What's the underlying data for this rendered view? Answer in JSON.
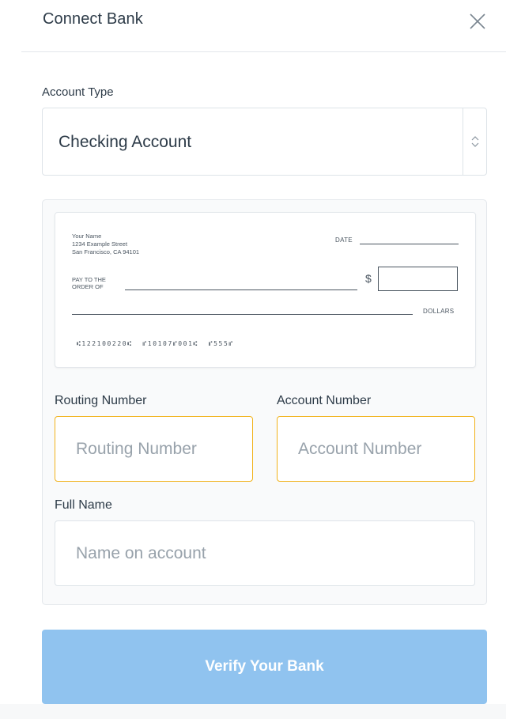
{
  "header": {
    "title": "Connect Bank",
    "close_icon": "close-icon"
  },
  "account_type": {
    "label": "Account Type",
    "selected_value": "Checking Account",
    "arrow_icon": "chevron-up-down-icon"
  },
  "check": {
    "address_line1": "Your Name",
    "address_line2": "1234 Example Street",
    "address_line3": "San Francisco, CA 94101",
    "date_label": "DATE",
    "pay_to_line1": "PAY TO THE",
    "pay_to_line2": "ORDER OF",
    "dollar_sign": "$",
    "dollars_label": "DOLLARS",
    "micr_line": "⑆122100220⑆  ⑈10107⑈001⑆  ⑈555⑈"
  },
  "routing": {
    "label": "Routing Number",
    "placeholder": "Routing Number",
    "value": ""
  },
  "account": {
    "label": "Account Number",
    "placeholder": "Account Number",
    "value": ""
  },
  "full_name": {
    "label": "Full Name",
    "placeholder": "Name on account",
    "value": ""
  },
  "verify_button": {
    "label": "Verify Your Bank"
  },
  "colors": {
    "accent_border": "#f1b21a",
    "button_bg": "#90c3ef",
    "text": "#2d3b48",
    "placeholder": "#98a2ab"
  }
}
